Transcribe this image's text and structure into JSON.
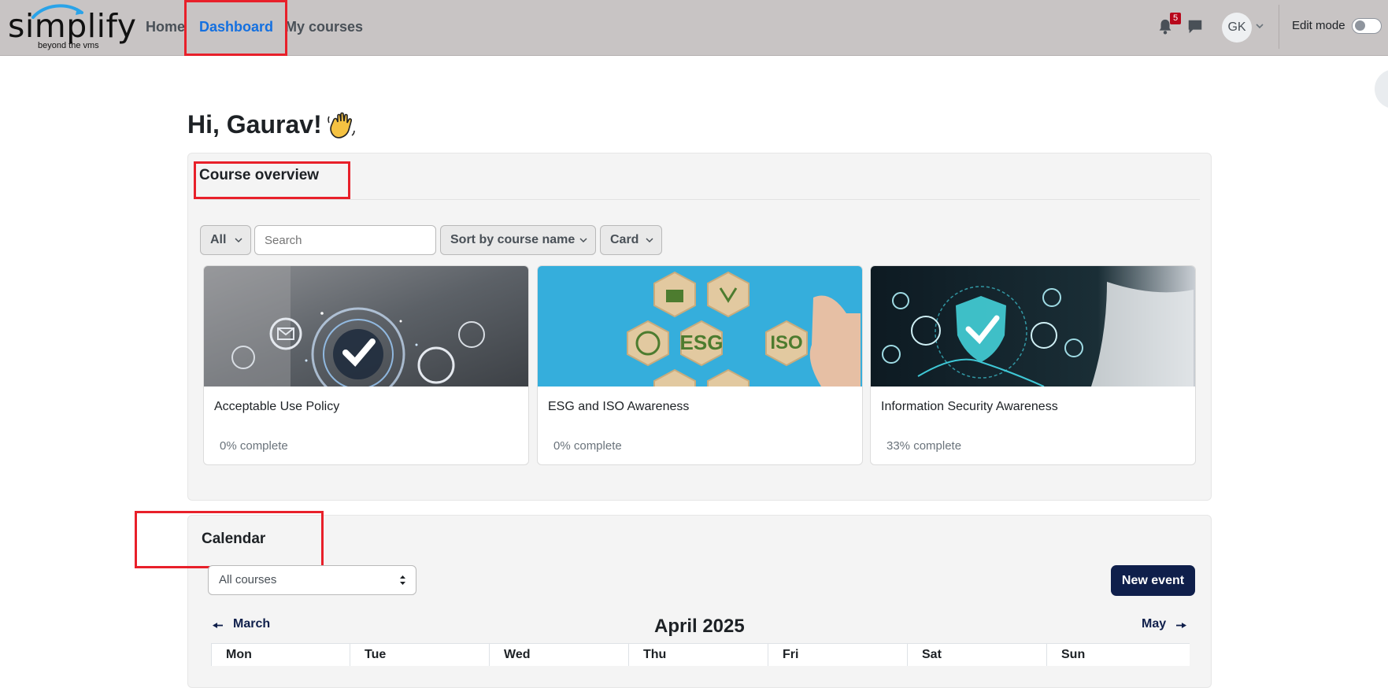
{
  "navbar": {
    "logo_text": "simplify",
    "logo_tagline": "beyond the vms",
    "links": [
      {
        "label": "Home"
      },
      {
        "label": "Dashboard",
        "active": true
      },
      {
        "label": "My courses"
      }
    ],
    "notifications_count": "5",
    "user_initials": "GK",
    "edit_mode_label": "Edit mode",
    "edit_mode_on": false,
    "accent_color": "#1470e0"
  },
  "greeting": "Hi, Gaurav!",
  "course_overview": {
    "title": "Course overview",
    "filter": "All",
    "search_placeholder": "Search",
    "sort": "Sort by course name",
    "view": "Card",
    "courses": [
      {
        "name": "Acceptable Use Policy",
        "progress_text": "0% complete",
        "progress": 0,
        "image": "policy-checkmark-image"
      },
      {
        "name": "ESG and ISO Awareness",
        "progress_text": "0% complete",
        "progress": 0,
        "image": "esg-iso-hexagons-image"
      },
      {
        "name": "Information Security Awareness",
        "progress_text": "33% complete",
        "progress": 33,
        "image": "security-shield-image"
      }
    ]
  },
  "calendar": {
    "title": "Calendar",
    "course_filter": "All courses",
    "new_event_label": "New event",
    "prev_month": "March",
    "current_month": "April 2025",
    "next_month": "May",
    "weekdays": [
      "Mon",
      "Tue",
      "Wed",
      "Thu",
      "Fri",
      "Sat",
      "Sun"
    ]
  },
  "colors": {
    "navbar_bg": "#c8c4c4",
    "highlight_box": "#e8202a",
    "primary_dark": "#0f1f4b",
    "notification_badge": "#b8071b"
  }
}
